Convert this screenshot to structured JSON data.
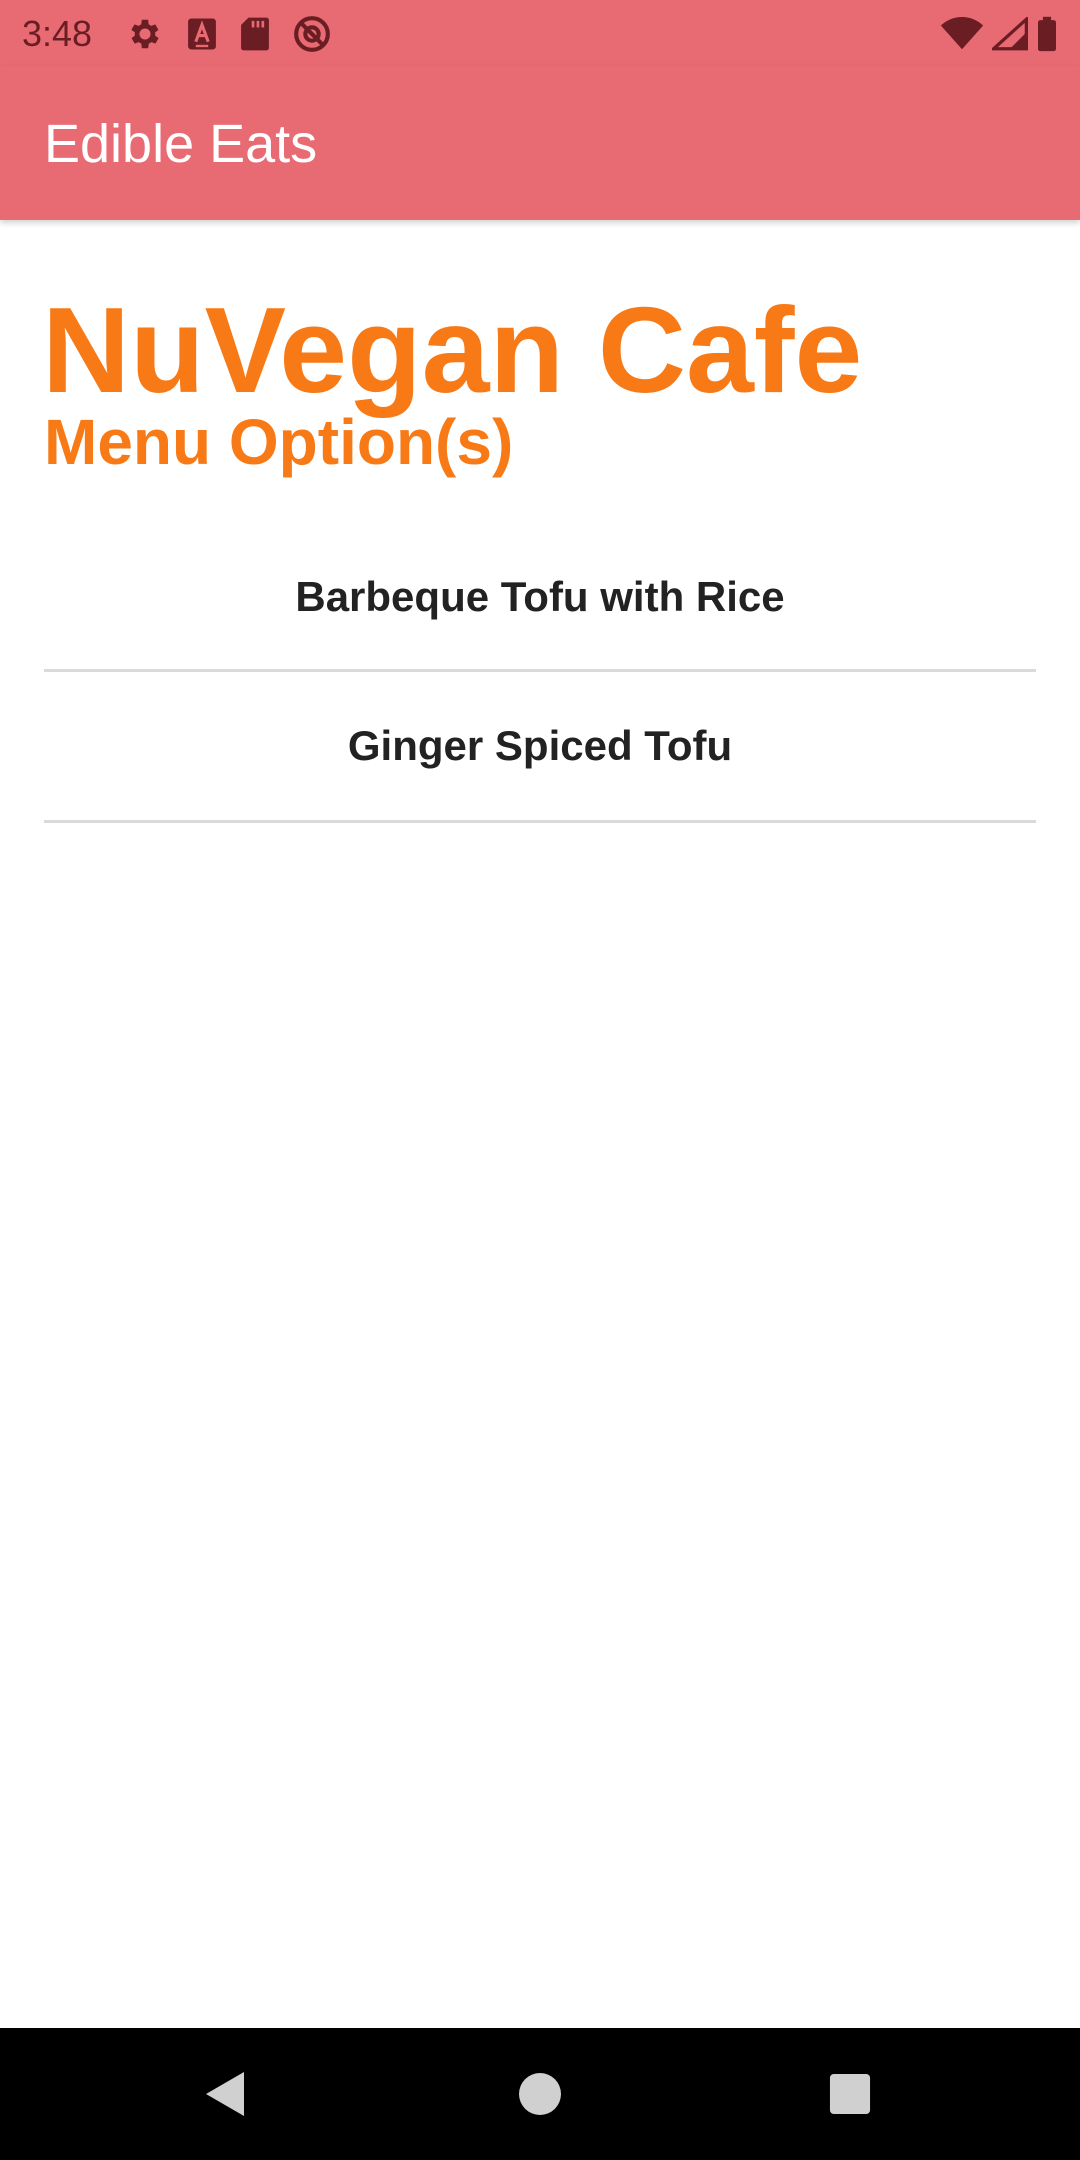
{
  "status_bar": {
    "time": "3:48",
    "left_icons": [
      "settings-icon",
      "text-a-icon",
      "sd-card-icon",
      "no-data-icon"
    ],
    "right_icons": [
      "wifi-icon",
      "signal-icon",
      "battery-icon"
    ],
    "color": "#6a1e24"
  },
  "app_bar": {
    "title": "Edible Eats",
    "background": "#e86a73"
  },
  "content": {
    "restaurant_name": "NuVegan Cafe",
    "menu_heading": "Menu Option(s)",
    "accent": "#f77a17",
    "menu_items": [
      {
        "label": "Barbeque Tofu with Rice"
      },
      {
        "label": "Ginger Spiced Tofu"
      }
    ]
  },
  "nav_bar": {
    "buttons": [
      "back-icon",
      "home-icon",
      "recents-icon"
    ]
  }
}
